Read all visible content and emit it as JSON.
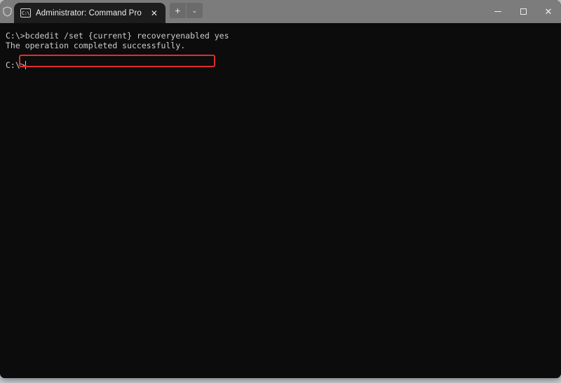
{
  "window": {
    "title": "Administrator: Command Pro",
    "background_color": "#0c0c0c",
    "titlebar_color": "#7c7c7c"
  },
  "titlebar": {
    "shield_icon": "shield-icon",
    "tabs": [
      {
        "label": "Administrator: Command Pro",
        "icon": "console-icon",
        "icon_text": "C:\\",
        "close_label": "✕",
        "active": true
      }
    ],
    "new_tab_label": "+",
    "tab_dropdown_label": "⌄",
    "window_controls": {
      "minimize_label": "—",
      "maximize_label": "□",
      "close_label": "✕"
    }
  },
  "terminal": {
    "prompt": "C:\\>",
    "lines": [
      {
        "type": "command",
        "prompt": "C:\\>",
        "text": "bcdedit /set {current} recoveryenabled yes",
        "highlighted": true
      },
      {
        "type": "output",
        "text": "The operation completed successfully."
      },
      {
        "type": "blank",
        "text": " "
      },
      {
        "type": "prompt",
        "text": "C:\\>",
        "cursor": true
      }
    ],
    "foreground_color": "#cccccc",
    "highlight_color": "#e02c2c"
  }
}
